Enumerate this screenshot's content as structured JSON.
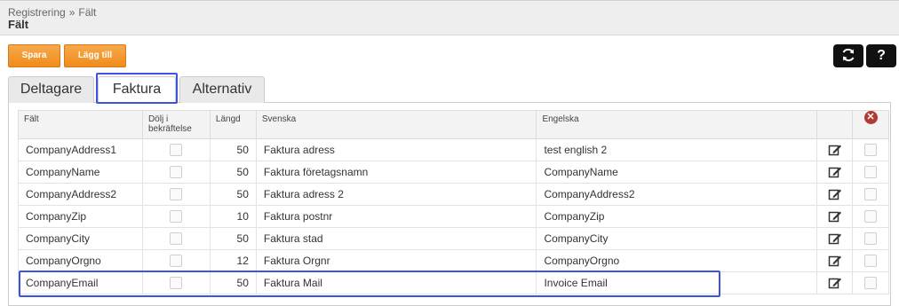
{
  "breadcrumb": {
    "parent": "Registrering",
    "separator": "»",
    "current": "Fält"
  },
  "page_title": "Fält",
  "toolbar": {
    "save_label": "Spara",
    "add_label": "Lägg till",
    "help_label": "?"
  },
  "tabs": [
    {
      "label": "Deltagare"
    },
    {
      "label": "Faktura"
    },
    {
      "label": "Alternativ"
    }
  ],
  "table": {
    "headers": {
      "field": "Fält",
      "hide": "Dölj i bekräftelse",
      "length": "Längd",
      "swedish": "Svenska",
      "english": "Engelska"
    },
    "rows": [
      {
        "field": "CompanyAddress1",
        "length": "50",
        "swedish": "Faktura adress",
        "english": "test english 2"
      },
      {
        "field": "CompanyName",
        "length": "50",
        "swedish": "Faktura företagsnamn",
        "english": "CompanyName"
      },
      {
        "field": "CompanyAddress2",
        "length": "50",
        "swedish": "Faktura adress 2",
        "english": "CompanyAddress2"
      },
      {
        "field": "CompanyZip",
        "length": "10",
        "swedish": "Faktura postnr",
        "english": "CompanyZip"
      },
      {
        "field": "CompanyCity",
        "length": "50",
        "swedish": "Faktura stad",
        "english": "CompanyCity"
      },
      {
        "field": "CompanyOrgno",
        "length": "12",
        "swedish": "Faktura Orgnr",
        "english": "CompanyOrgno"
      },
      {
        "field": "CompanyEmail",
        "length": "50",
        "swedish": "Faktura Mail",
        "english": "Invoice Email"
      }
    ]
  },
  "colors": {
    "accent_orange": "#f08c1c",
    "highlight_blue": "#3c55e0",
    "delete_red": "#b13a35"
  },
  "icons": {
    "refresh": "refresh-icon",
    "delete_all": "delete-icon",
    "edit": "edit-icon"
  }
}
